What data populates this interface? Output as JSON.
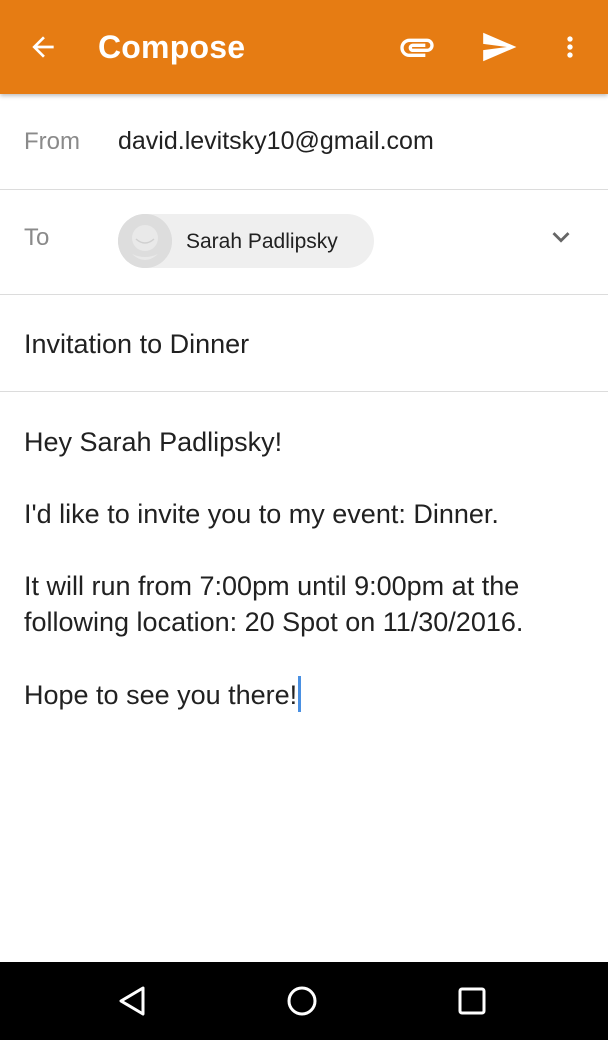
{
  "appbar": {
    "title": "Compose",
    "icons": {
      "back": "arrow-left-icon",
      "attach": "paperclip-icon",
      "send": "send-icon",
      "more": "more-vert-icon"
    },
    "color": "#e67c13"
  },
  "from": {
    "label": "From",
    "value": "david.levitsky10@gmail.com"
  },
  "to": {
    "label": "To",
    "recipients": [
      {
        "name": "Sarah Padlipsky",
        "avatar": "default-avatar-icon"
      }
    ],
    "expand_icon": "chevron-down-icon"
  },
  "subject": {
    "value": "Invitation to Dinner"
  },
  "body": {
    "paragraphs": [
      "Hey Sarah Padlipsky!",
      "I'd like to invite you to my event: Dinner.",
      "It will run from 7:00pm until 9:00pm at the following location: 20 Spot on 11/30/2016.",
      "Hope to see you there!"
    ]
  },
  "navbar": {
    "icons": [
      "back-triangle-icon",
      "home-circle-icon",
      "recents-square-icon"
    ]
  }
}
